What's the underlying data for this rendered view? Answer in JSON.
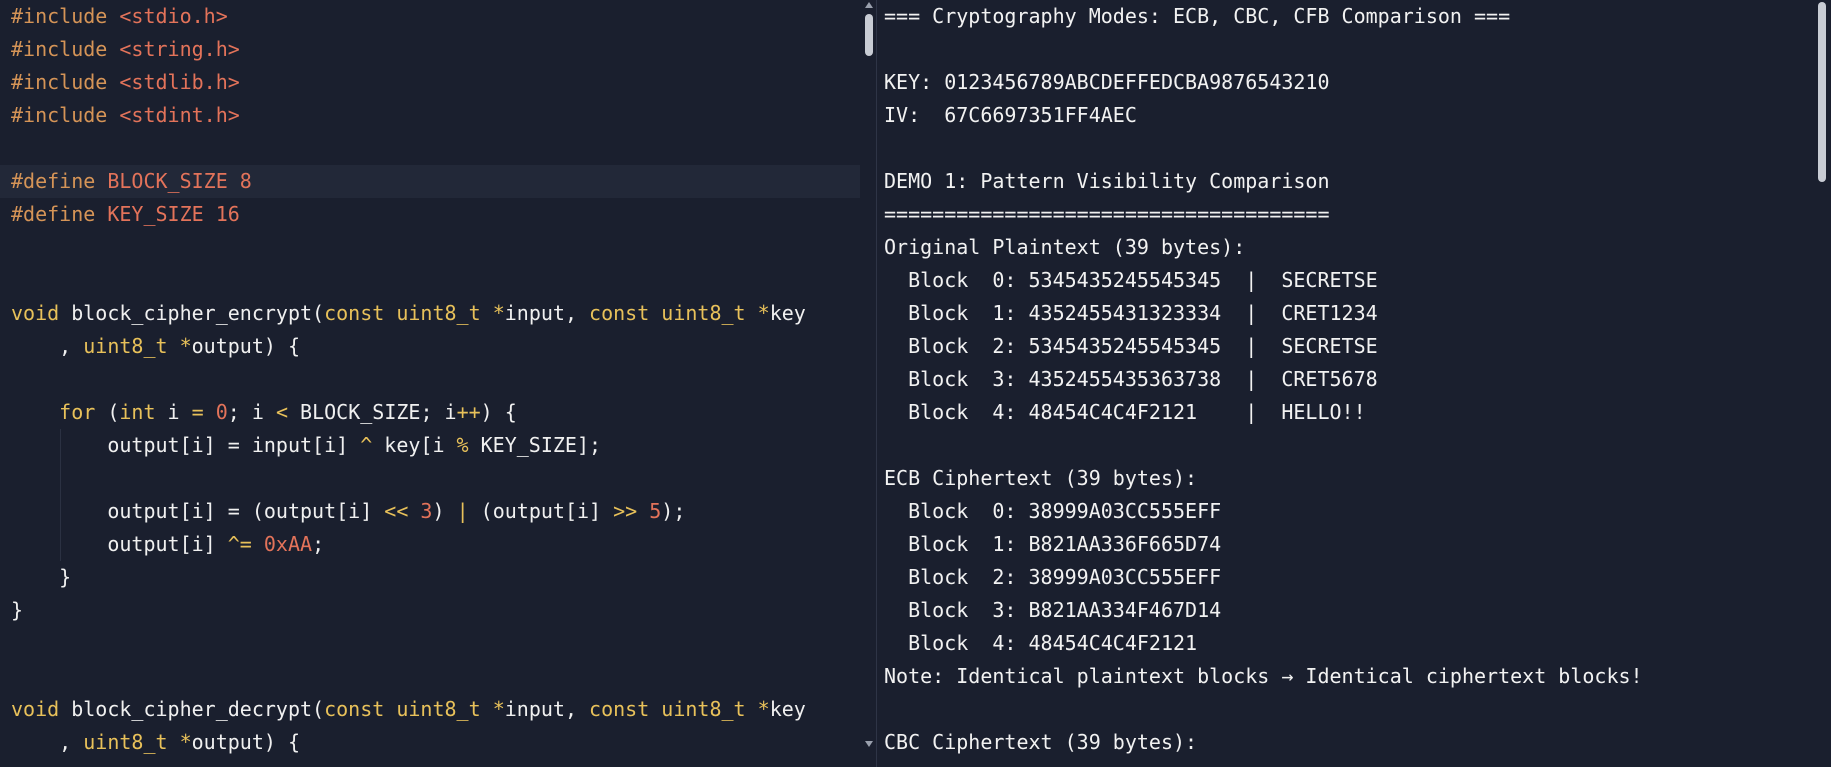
{
  "editor": {
    "lines": [
      [
        {
          "c": "t-pp",
          "t": "#include "
        },
        {
          "c": "t-inc",
          "t": "<stdio.h>"
        }
      ],
      [
        {
          "c": "t-pp",
          "t": "#include "
        },
        {
          "c": "t-inc",
          "t": "<string.h>"
        }
      ],
      [
        {
          "c": "t-pp",
          "t": "#include "
        },
        {
          "c": "t-inc",
          "t": "<stdlib.h>"
        }
      ],
      [
        {
          "c": "t-pp",
          "t": "#include "
        },
        {
          "c": "t-inc",
          "t": "<stdint.h>"
        }
      ],
      [],
      [
        {
          "c": "t-pp",
          "t": "#define "
        },
        {
          "c": "t-mac",
          "t": "BLOCK_SIZE 8"
        }
      ],
      [
        {
          "c": "t-pp",
          "t": "#define "
        },
        {
          "c": "t-mac",
          "t": "KEY_SIZE 16"
        }
      ],
      [],
      [],
      [
        {
          "c": "t-vd",
          "t": "void"
        },
        {
          "c": "t-plain",
          "t": " block_cipher_encrypt("
        },
        {
          "c": "t-kw",
          "t": "const"
        },
        {
          "c": "t-plain",
          "t": " "
        },
        {
          "c": "t-ty",
          "t": "uint8_t"
        },
        {
          "c": "t-plain",
          "t": " "
        },
        {
          "c": "t-op",
          "t": "*"
        },
        {
          "c": "t-plain",
          "t": "input, "
        },
        {
          "c": "t-kw",
          "t": "const"
        },
        {
          "c": "t-plain",
          "t": " "
        },
        {
          "c": "t-ty",
          "t": "uint8_t"
        },
        {
          "c": "t-plain",
          "t": " "
        },
        {
          "c": "t-op",
          "t": "*"
        },
        {
          "c": "t-plain",
          "t": "key"
        }
      ],
      [
        {
          "c": "t-plain",
          "t": "    , "
        },
        {
          "c": "t-ty",
          "t": "uint8_t"
        },
        {
          "c": "t-plain",
          "t": " "
        },
        {
          "c": "t-op",
          "t": "*"
        },
        {
          "c": "t-plain",
          "t": "output) {"
        }
      ],
      [],
      [
        {
          "c": "t-plain",
          "t": "    "
        },
        {
          "c": "t-kw",
          "t": "for"
        },
        {
          "c": "t-plain",
          "t": " ("
        },
        {
          "c": "t-ty",
          "t": "int"
        },
        {
          "c": "t-plain",
          "t": " i "
        },
        {
          "c": "t-op",
          "t": "="
        },
        {
          "c": "t-plain",
          "t": " "
        },
        {
          "c": "t-num",
          "t": "0"
        },
        {
          "c": "t-plain",
          "t": "; i "
        },
        {
          "c": "t-op",
          "t": "<"
        },
        {
          "c": "t-plain",
          "t": " BLOCK_SIZE; i"
        },
        {
          "c": "t-op",
          "t": "++"
        },
        {
          "c": "t-plain",
          "t": ") {"
        }
      ],
      [
        {
          "c": "t-plain",
          "t": "        output[i] = input[i] "
        },
        {
          "c": "t-op",
          "t": "^"
        },
        {
          "c": "t-plain",
          "t": " key[i "
        },
        {
          "c": "t-op",
          "t": "%"
        },
        {
          "c": "t-plain",
          "t": " KEY_SIZE];"
        }
      ],
      [],
      [
        {
          "c": "t-plain",
          "t": "        output[i] = (output[i] "
        },
        {
          "c": "t-op",
          "t": "<<"
        },
        {
          "c": "t-plain",
          "t": " "
        },
        {
          "c": "t-num",
          "t": "3"
        },
        {
          "c": "t-plain",
          "t": ") "
        },
        {
          "c": "t-op",
          "t": "|"
        },
        {
          "c": "t-plain",
          "t": " (output[i] "
        },
        {
          "c": "t-op",
          "t": ">>"
        },
        {
          "c": "t-plain",
          "t": " "
        },
        {
          "c": "t-num",
          "t": "5"
        },
        {
          "c": "t-plain",
          "t": ");"
        }
      ],
      [
        {
          "c": "t-plain",
          "t": "        output[i] "
        },
        {
          "c": "t-op",
          "t": "^="
        },
        {
          "c": "t-plain",
          "t": " "
        },
        {
          "c": "t-num",
          "t": "0xAA"
        },
        {
          "c": "t-plain",
          "t": ";"
        }
      ],
      [
        {
          "c": "t-plain",
          "t": "    }"
        }
      ],
      [
        {
          "c": "t-plain",
          "t": "}"
        }
      ],
      [],
      [],
      [
        {
          "c": "t-vd",
          "t": "void"
        },
        {
          "c": "t-plain",
          "t": " block_cipher_decrypt("
        },
        {
          "c": "t-kw",
          "t": "const"
        },
        {
          "c": "t-plain",
          "t": " "
        },
        {
          "c": "t-ty",
          "t": "uint8_t"
        },
        {
          "c": "t-plain",
          "t": " "
        },
        {
          "c": "t-op",
          "t": "*"
        },
        {
          "c": "t-plain",
          "t": "input, "
        },
        {
          "c": "t-kw",
          "t": "const"
        },
        {
          "c": "t-plain",
          "t": " "
        },
        {
          "c": "t-ty",
          "t": "uint8_t"
        },
        {
          "c": "t-plain",
          "t": " "
        },
        {
          "c": "t-op",
          "t": "*"
        },
        {
          "c": "t-plain",
          "t": "key"
        }
      ],
      [
        {
          "c": "t-plain",
          "t": "    , "
        },
        {
          "c": "t-ty",
          "t": "uint8_t"
        },
        {
          "c": "t-plain",
          "t": " "
        },
        {
          "c": "t-op",
          "t": "*"
        },
        {
          "c": "t-plain",
          "t": "output) {"
        }
      ]
    ]
  },
  "output": {
    "lines": [
      "=== Cryptography Modes: ECB, CBC, CFB Comparison ===",
      "",
      "KEY: 0123456789ABCDEFFEDCBA9876543210",
      "IV:  67C6697351FF4AEC",
      "",
      "DEMO 1: Pattern Visibility Comparison",
      "=====================================",
      "Original Plaintext (39 bytes):",
      "  Block  0: 5345435245545345  |  SECRETSE",
      "  Block  1: 4352455431323334  |  CRET1234",
      "  Block  2: 5345435245545345  |  SECRETSE",
      "  Block  3: 4352455435363738  |  CRET5678",
      "  Block  4: 48454C4C4F2121    |  HELLO!!",
      "",
      "ECB Ciphertext (39 bytes):",
      "  Block  0: 38999A03CC555EFF",
      "  Block  1: B821AA336F665D74",
      "  Block  2: 38999A03CC555EFF",
      "  Block  3: B821AA334F467D14",
      "  Block  4: 48454C4C4F2121",
      "Note: Identical plaintext blocks → Identical ciphertext blocks!",
      "",
      "CBC Ciphertext (39 bytes):"
    ]
  },
  "colors": {
    "background": "#1a1f2e",
    "preprocessor": "#d59457",
    "literal": "#e3735a",
    "keyword": "#e8c15a",
    "text": "#f0f0f0"
  }
}
